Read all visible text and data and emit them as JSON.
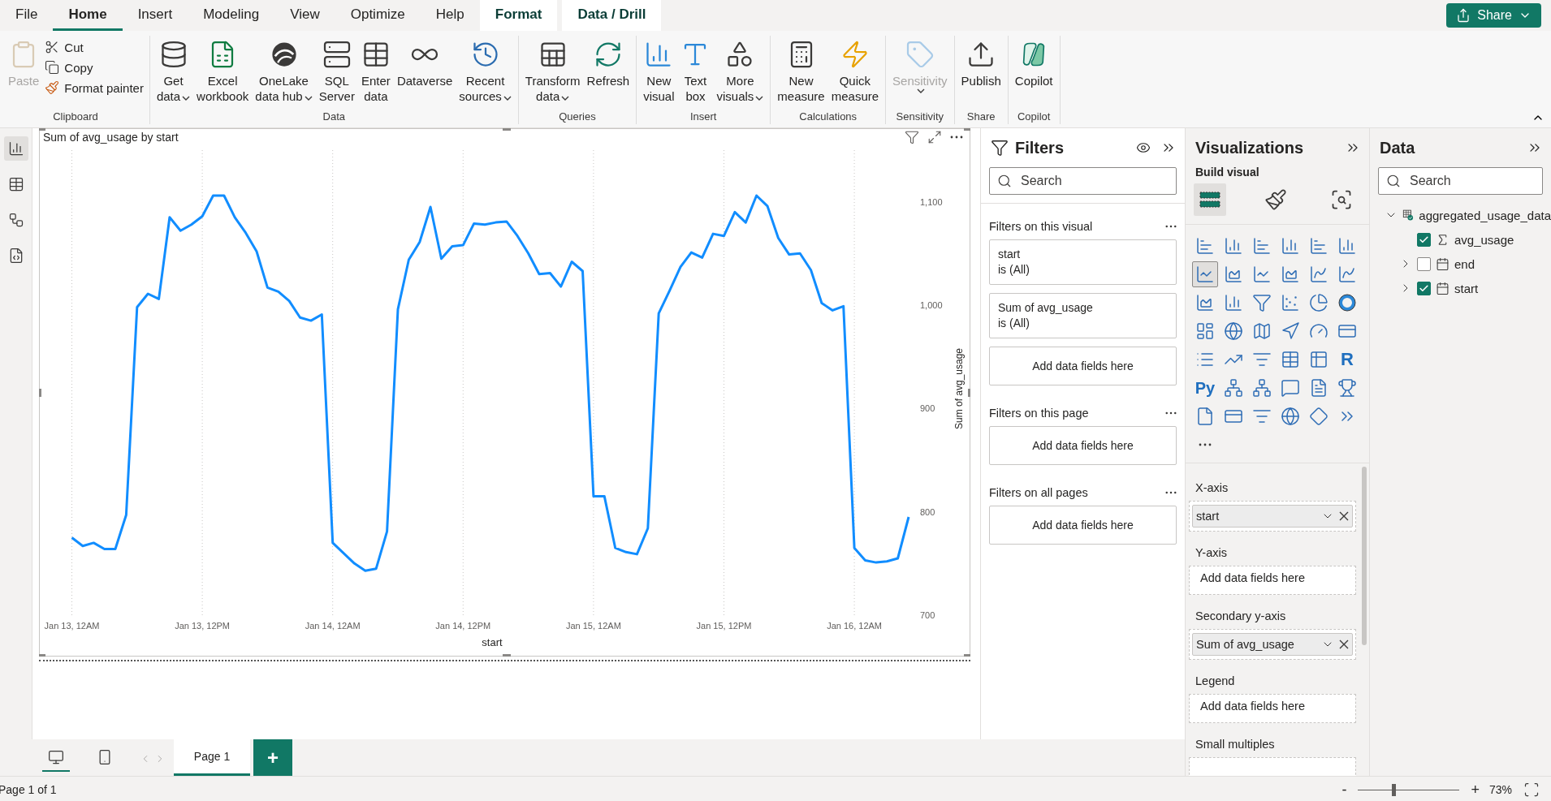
{
  "menu_tabs": [
    {
      "label": "File",
      "kind": "plain",
      "selected": false
    },
    {
      "label": "Home",
      "kind": "plain",
      "selected": true
    },
    {
      "label": "Insert",
      "kind": "plain",
      "selected": false
    },
    {
      "label": "Modeling",
      "kind": "plain",
      "selected": false
    },
    {
      "label": "View",
      "kind": "plain",
      "selected": false
    },
    {
      "label": "Optimize",
      "kind": "plain",
      "selected": false
    },
    {
      "label": "Help",
      "kind": "plain",
      "selected": false
    },
    {
      "label": "Format",
      "kind": "contextual",
      "selected": false
    },
    {
      "label": "Data / Drill",
      "kind": "contextual",
      "selected": false
    }
  ],
  "share_button": {
    "label": "Share"
  },
  "ribbon": [
    {
      "label": "Clipboard",
      "buttons": [
        {
          "kind": "paste",
          "label": [
            "Paste"
          ],
          "dropdown": false,
          "disabled": true
        }
      ],
      "small_buttons": [
        {
          "kind": "cut",
          "label": "Cut"
        },
        {
          "kind": "copy",
          "label": "Copy"
        },
        {
          "kind": "painter",
          "label": "Format painter"
        }
      ]
    },
    {
      "label": "Data",
      "buttons": [
        {
          "kind": "getdata",
          "label": [
            "Get",
            "data"
          ],
          "dropdown": true,
          "disabled": false
        },
        {
          "kind": "excel",
          "label": [
            "Excel",
            "workbook"
          ],
          "dropdown": false,
          "disabled": false
        },
        {
          "kind": "onelake",
          "label": [
            "OneLake",
            "data hub"
          ],
          "dropdown": true,
          "disabled": false
        },
        {
          "kind": "sql",
          "label": [
            "SQL",
            "Server"
          ],
          "dropdown": false,
          "disabled": false
        },
        {
          "kind": "enter",
          "label": [
            "Enter",
            "data"
          ],
          "dropdown": false,
          "disabled": false
        },
        {
          "kind": "dataverse",
          "label": [
            "Dataverse"
          ],
          "dropdown": false,
          "disabled": false
        },
        {
          "kind": "recent",
          "label": [
            "Recent",
            "sources"
          ],
          "dropdown": true,
          "disabled": false
        }
      ]
    },
    {
      "label": "Queries",
      "buttons": [
        {
          "kind": "transform",
          "label": [
            "Transform",
            "data"
          ],
          "dropdown": true,
          "disabled": false
        },
        {
          "kind": "refresh",
          "label": [
            "Refresh"
          ],
          "dropdown": false,
          "disabled": false
        }
      ]
    },
    {
      "label": "Insert",
      "buttons": [
        {
          "kind": "newvisual",
          "label": [
            "New",
            "visual"
          ],
          "dropdown": false,
          "disabled": false
        },
        {
          "kind": "textbox",
          "label": [
            "Text",
            "box"
          ],
          "dropdown": false,
          "disabled": false
        },
        {
          "kind": "morevisuals",
          "label": [
            "More",
            "visuals"
          ],
          "dropdown": true,
          "disabled": false
        }
      ]
    },
    {
      "label": "Calculations",
      "buttons": [
        {
          "kind": "measure",
          "label": [
            "New",
            "measure"
          ],
          "dropdown": false,
          "disabled": false
        },
        {
          "kind": "quick",
          "label": [
            "Quick",
            "measure"
          ],
          "dropdown": false,
          "disabled": false
        }
      ]
    },
    {
      "label": "Sensitivity",
      "buttons": [
        {
          "kind": "sensitivity",
          "label": [
            "Sensitivity"
          ],
          "dropdown": true,
          "disabled": true
        }
      ]
    },
    {
      "label": "Share",
      "buttons": [
        {
          "kind": "publish",
          "label": [
            "Publish"
          ],
          "dropdown": false,
          "disabled": false
        }
      ]
    },
    {
      "label": "Copilot",
      "buttons": [
        {
          "kind": "copilot",
          "label": [
            "Copilot"
          ],
          "dropdown": false,
          "disabled": false
        }
      ]
    }
  ],
  "views": [
    {
      "kind": "report",
      "selected": true
    },
    {
      "kind": "table",
      "selected": false
    },
    {
      "kind": "model",
      "selected": false
    },
    {
      "kind": "dax",
      "selected": false
    }
  ],
  "visual": {
    "title": "Sum of avg_usage by start",
    "chart_data": {
      "type": "line",
      "xlabel": "start",
      "ylabel": "Sum of avg_usage",
      "categories": [
        "Jan 13, 12AM",
        null,
        null,
        null,
        null,
        null,
        null,
        null,
        null,
        null,
        null,
        null,
        "Jan 13, 12PM",
        null,
        null,
        null,
        null,
        null,
        null,
        null,
        null,
        null,
        null,
        null,
        "Jan 14, 12AM",
        null,
        null,
        null,
        null,
        null,
        null,
        null,
        null,
        null,
        null,
        null,
        "Jan 14, 12PM",
        null,
        null,
        null,
        null,
        null,
        null,
        null,
        null,
        null,
        null,
        null,
        "Jan 15, 12AM",
        null,
        null,
        null,
        null,
        null,
        null,
        null,
        null,
        null,
        null,
        null,
        "Jan 15, 12PM",
        null,
        null,
        null,
        null,
        null,
        null,
        null,
        null,
        null,
        null,
        null,
        "Jan 16, 12AM",
        null,
        null,
        null,
        null,
        null
      ],
      "series": [
        {
          "color": "#118dff",
          "values": [
            775,
            767,
            770,
            764,
            764,
            797,
            998,
            1011,
            1006,
            1085,
            1072,
            1078,
            1086,
            1106,
            1106,
            1085,
            1070,
            1052,
            1017,
            1013,
            1004,
            988,
            985,
            991,
            770,
            760,
            750,
            743,
            745,
            781,
            996,
            1044,
            1061,
            1095,
            1045,
            1057,
            1058,
            1079,
            1078,
            1080,
            1081,
            1067,
            1050,
            1030,
            1031,
            1018,
            1042,
            1033,
            815,
            815,
            765,
            761,
            759,
            784,
            992,
            1014,
            1037,
            1051,
            1046,
            1069,
            1067,
            1090,
            1080,
            1106,
            1096,
            1065,
            1049,
            1050,
            1034,
            1002,
            995,
            999,
            765,
            753,
            751,
            752,
            755,
            795
          ]
        }
      ],
      "ylim": [
        700,
        1150
      ],
      "grid": true,
      "yticks": [
        {
          "value": 700,
          "label": "700"
        },
        {
          "value": 800,
          "label": "800"
        },
        {
          "value": 900,
          "label": "900"
        },
        {
          "value": 1000,
          "label": "1,000"
        },
        {
          "value": 1100,
          "label": "1,100"
        }
      ]
    }
  },
  "filters": {
    "title": "Filters",
    "search": {
      "placeholder": "Search"
    },
    "sections": [
      {
        "title": "Filters on this visual",
        "cards": [
          {
            "field": "start",
            "condition": "is (All)"
          },
          {
            "field": "Sum of avg_usage",
            "condition": "is (All)"
          }
        ],
        "drop": "Add data fields here"
      },
      {
        "title": "Filters on this page",
        "drop": "Add data fields here"
      },
      {
        "title": "Filters on all pages",
        "drop": "Add data fields here"
      }
    ]
  },
  "visualizations": {
    "title": "Visualizations",
    "subtitle": "Build visual",
    "modes": [
      {
        "kind": "build",
        "selected": true
      },
      {
        "kind": "format",
        "selected": false
      },
      {
        "kind": "analytics",
        "selected": false
      }
    ],
    "gallery": [
      {
        "kind": "hbar",
        "selected": false
      },
      {
        "kind": "col",
        "selected": false
      },
      {
        "kind": "hbar",
        "selected": false
      },
      {
        "kind": "col",
        "selected": false
      },
      {
        "kind": "hbar",
        "selected": false
      },
      {
        "kind": "col",
        "selected": false
      },
      {
        "kind": "line",
        "selected": true
      },
      {
        "kind": "area",
        "selected": false
      },
      {
        "kind": "line",
        "selected": false
      },
      {
        "kind": "area",
        "selected": false
      },
      {
        "kind": "combo",
        "selected": false
      },
      {
        "kind": "combo",
        "selected": false
      },
      {
        "kind": "area",
        "selected": false
      },
      {
        "kind": "col",
        "selected": false
      },
      {
        "kind": "funnel",
        "selected": false
      },
      {
        "kind": "scatter",
        "selected": false
      },
      {
        "kind": "pie",
        "selected": false
      },
      {
        "kind": "donut",
        "selected": false
      },
      {
        "kind": "treemap",
        "selected": false
      },
      {
        "kind": "globe",
        "selected": false
      },
      {
        "kind": "map",
        "selected": false
      },
      {
        "kind": "arrow",
        "selected": false
      },
      {
        "kind": "gauge",
        "selected": false
      },
      {
        "kind": "card",
        "selected": false
      },
      {
        "kind": "list",
        "selected": false
      },
      {
        "kind": "kpi",
        "selected": false
      },
      {
        "kind": "filter",
        "selected": false
      },
      {
        "kind": "table",
        "selected": false
      },
      {
        "kind": "matrix",
        "selected": false
      },
      {
        "kind": "letter",
        "label": "R",
        "selected": false
      },
      {
        "kind": "letter",
        "label": "Py",
        "selected": false
      },
      {
        "kind": "tree",
        "selected": false
      },
      {
        "kind": "tree",
        "selected": false
      },
      {
        "kind": "chat",
        "selected": false
      },
      {
        "kind": "doc",
        "selected": false
      },
      {
        "kind": "trophy",
        "selected": false
      },
      {
        "kind": "report",
        "selected": false
      },
      {
        "kind": "card",
        "selected": false
      },
      {
        "kind": "filter",
        "selected": false
      },
      {
        "kind": "globe",
        "selected": false
      },
      {
        "kind": "diamond",
        "selected": false
      },
      {
        "kind": "chevron",
        "selected": false
      }
    ],
    "wells": [
      {
        "label": "X-axis",
        "fields": [
          "start"
        ]
      },
      {
        "label": "Y-axis",
        "placeholder": "Add data fields here"
      },
      {
        "label": "Secondary y-axis",
        "fields": [
          "Sum of avg_usage"
        ]
      },
      {
        "label": "Legend",
        "placeholder": "Add data fields here"
      },
      {
        "label": "Small multiples"
      }
    ]
  },
  "data_pane": {
    "title": "Data",
    "search": {
      "placeholder": "Search"
    },
    "tree": [
      {
        "label": "aggregated_usage_data",
        "kind": "table",
        "expanded": true,
        "children": [
          {
            "label": "avg_usage",
            "kind": "measure",
            "checked": true
          },
          {
            "label": "end",
            "kind": "date",
            "checked": false,
            "expanded": false
          },
          {
            "label": "start",
            "kind": "date",
            "checked": true,
            "expanded": false
          }
        ]
      }
    ]
  },
  "pages": {
    "devices": [
      {
        "kind": "desktop",
        "selected": true
      },
      {
        "kind": "mobile",
        "selected": false
      }
    ],
    "tabs": [
      {
        "label": "Page 1",
        "selected": true
      }
    ],
    "add": "+"
  },
  "status_bar": {
    "page": "Page 1 of 1",
    "zoom_out": "-",
    "zoom_in": "+",
    "zoom": {
      "level": 0.35
    },
    "zoom_label": "73%"
  }
}
